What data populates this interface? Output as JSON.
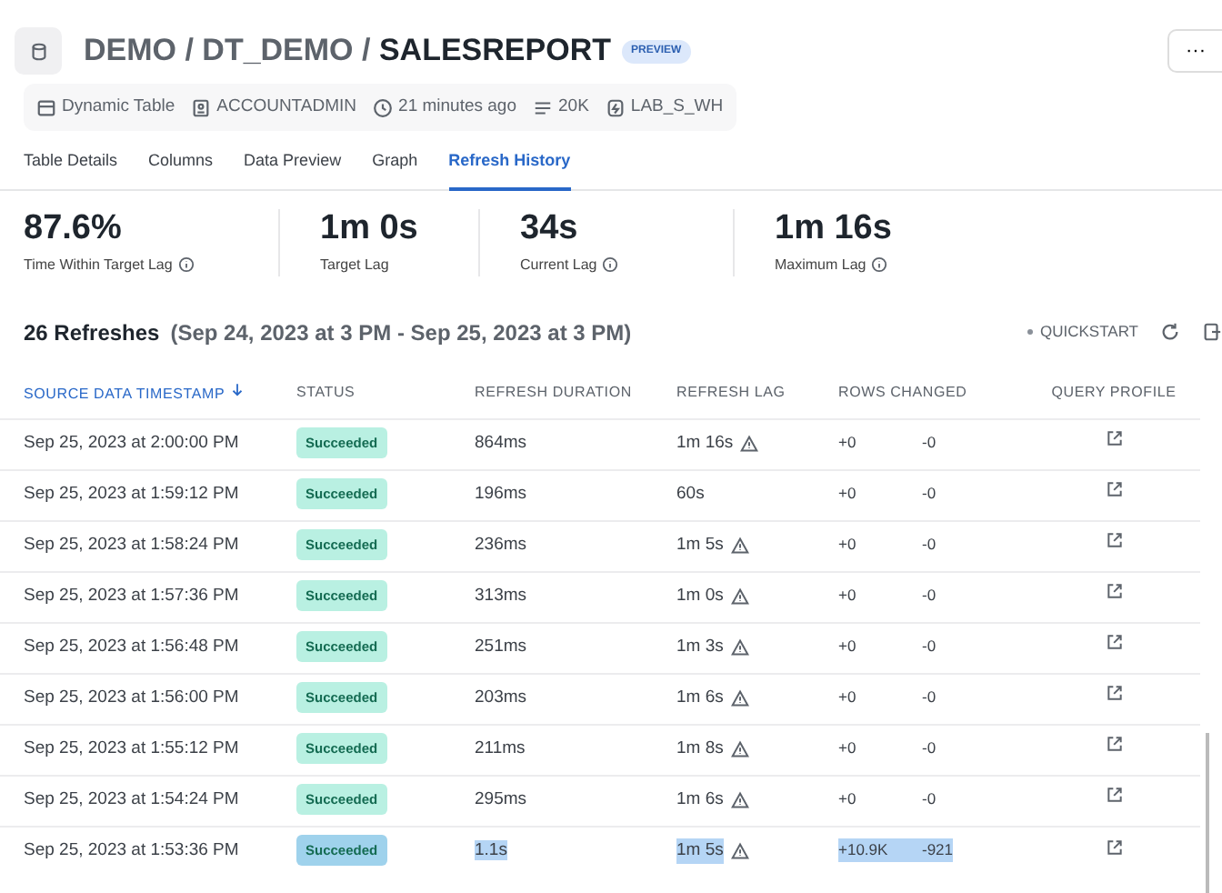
{
  "header": {
    "path": "DEMO / DT_DEMO /",
    "title": "SALESREPORT",
    "badge": "PREVIEW",
    "more": "···"
  },
  "meta": [
    {
      "kind": "table",
      "text": "Dynamic Table"
    },
    {
      "kind": "role",
      "text": "ACCOUNTADMIN"
    },
    {
      "kind": "clock",
      "text": "21 minutes ago"
    },
    {
      "kind": "rows",
      "text": "20K"
    },
    {
      "kind": "warehouse",
      "text": "LAB_S_WH"
    }
  ],
  "tabs": [
    {
      "label": "Table Details",
      "selected": false
    },
    {
      "label": "Columns",
      "selected": false
    },
    {
      "label": "Data Preview",
      "selected": false
    },
    {
      "label": "Graph",
      "selected": false
    },
    {
      "label": "Refresh History",
      "selected": true
    }
  ],
  "stats": [
    {
      "value": "87.6%",
      "label": "Time Within Target Lag",
      "info": true
    },
    {
      "value": "1m 0s",
      "label": "Target Lag",
      "info": false
    },
    {
      "value": "34s",
      "label": "Current Lag",
      "info": true
    },
    {
      "value": "1m 16s",
      "label": "Maximum Lag",
      "info": true
    }
  ],
  "refreshes": {
    "count": "26 Refreshes",
    "range": "(Sep 24, 2023 at 3 PM - Sep 25, 2023 at 3 PM)",
    "quickstart": "QUICKSTART"
  },
  "table": {
    "columns": [
      "SOURCE DATA TIMESTAMP",
      "STATUS",
      "REFRESH DURATION",
      "REFRESH LAG",
      "ROWS CHANGED",
      "QUERY PROFILE"
    ],
    "rows": [
      {
        "timestamp": "Sep 25, 2023 at 2:00:00 PM",
        "status": "Succeeded",
        "duration": "864ms",
        "lag": "1m 16s",
        "warning": true,
        "added": "+0",
        "removed": "-0",
        "highlighted": false
      },
      {
        "timestamp": "Sep 25, 2023 at 1:59:12 PM",
        "status": "Succeeded",
        "duration": "196ms",
        "lag": "60s",
        "warning": false,
        "added": "+0",
        "removed": "-0",
        "highlighted": false
      },
      {
        "timestamp": "Sep 25, 2023 at 1:58:24 PM",
        "status": "Succeeded",
        "duration": "236ms",
        "lag": "1m 5s",
        "warning": true,
        "added": "+0",
        "removed": "-0",
        "highlighted": false
      },
      {
        "timestamp": "Sep 25, 2023 at 1:57:36 PM",
        "status": "Succeeded",
        "duration": "313ms",
        "lag": "1m 0s",
        "warning": true,
        "added": "+0",
        "removed": "-0",
        "highlighted": false
      },
      {
        "timestamp": "Sep 25, 2023 at 1:56:48 PM",
        "status": "Succeeded",
        "duration": "251ms",
        "lag": "1m 3s",
        "warning": true,
        "added": "+0",
        "removed": "-0",
        "highlighted": false
      },
      {
        "timestamp": "Sep 25, 2023 at 1:56:00 PM",
        "status": "Succeeded",
        "duration": "203ms",
        "lag": "1m 6s",
        "warning": true,
        "added": "+0",
        "removed": "-0",
        "highlighted": false
      },
      {
        "timestamp": "Sep 25, 2023 at 1:55:12 PM",
        "status": "Succeeded",
        "duration": "211ms",
        "lag": "1m 8s",
        "warning": true,
        "added": "+0",
        "removed": "-0",
        "highlighted": false
      },
      {
        "timestamp": "Sep 25, 2023 at 1:54:24 PM",
        "status": "Succeeded",
        "duration": "295ms",
        "lag": "1m 6s",
        "warning": true,
        "added": "+0",
        "removed": "-0",
        "highlighted": false
      },
      {
        "timestamp": "Sep 25, 2023 at 1:53:36 PM",
        "status": "Succeeded",
        "duration": "1.1s",
        "lag": "1m 5s",
        "warning": true,
        "added": "+10.9K",
        "removed": "-921",
        "highlighted": true
      }
    ]
  }
}
